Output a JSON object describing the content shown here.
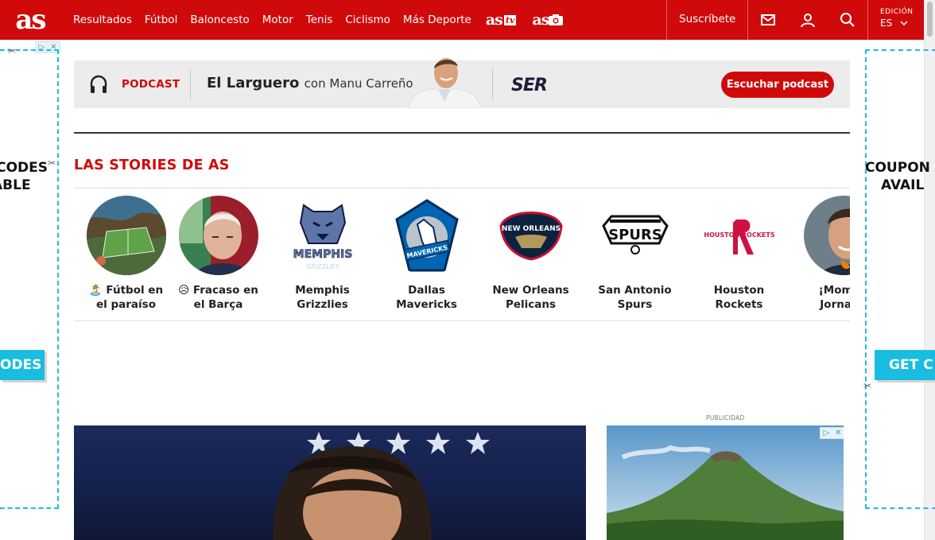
{
  "header": {
    "logo": "as",
    "nav": [
      "Resultados",
      "Fútbol",
      "Baloncesto",
      "Motor",
      "Tenis",
      "Ciclismo",
      "Más Deporte"
    ],
    "brand_tv": "as",
    "brand_tv_tag": "tv",
    "brand_photo": "as",
    "subscribe": "Suscríbete",
    "edition_label": "EDICIÓN",
    "edition_value": "ES",
    "colors": {
      "brand_red": "#d00a0a"
    }
  },
  "side_ads": {
    "left_text_line1": "CODES",
    "left_text_line2": "ABLE",
    "left_button": "ODES",
    "right_text_line1": "COUPON",
    "right_text_line2": "AVAIL",
    "right_button": "GET C",
    "accent": "#19bde0"
  },
  "podcast": {
    "label": "PODCAST",
    "title": "El Larguero",
    "subtitle": "con Manu Carreño",
    "network": "SER",
    "button": "Escuchar podcast"
  },
  "stories": {
    "title": "LAS STORIES DE AS",
    "items": [
      {
        "line1": "🏝️ Fútbol en",
        "line2": "el paraíso",
        "icon": "stadium-photo"
      },
      {
        "line1": "😥 Fracaso en",
        "line2": "el Barça",
        "icon": "portrait-photo"
      },
      {
        "line1": "Memphis",
        "line2": "Grizzlies",
        "icon": "grizzlies-logo",
        "logo_text": "MEMPHIS"
      },
      {
        "line1": "Dallas",
        "line2": "Mavericks",
        "icon": "mavericks-logo",
        "logo_text": "MAVERICKS"
      },
      {
        "line1": "New Orleans",
        "line2": "Pelicans",
        "icon": "pelicans-logo",
        "logo_text": "NEW ORLEANS"
      },
      {
        "line1": "San Antonio",
        "line2": "Spurs",
        "icon": "spurs-logo",
        "logo_text": "SPURS"
      },
      {
        "line1": "Houston",
        "line2": "Rockets",
        "icon": "rockets-logo",
        "logo_text": "HOUSTON ROCKETS"
      },
      {
        "line1": "¡Momen",
        "line2": "Jornada",
        "icon": "portrait-photo"
      }
    ]
  },
  "ad": {
    "label": "PUBLICIDAD"
  }
}
